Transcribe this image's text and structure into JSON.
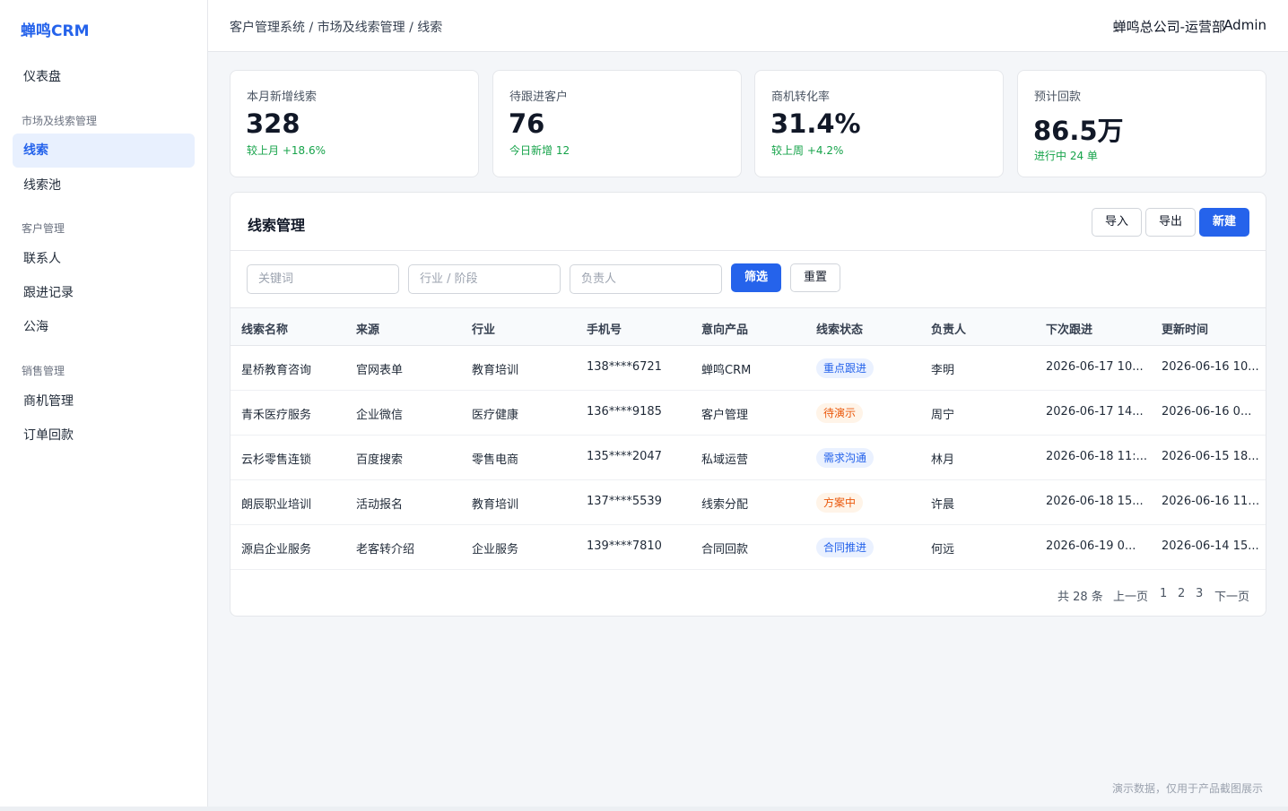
{
  "sidebar": {
    "brand": "蝉鸣CRM",
    "dashboard": "仪表盘",
    "group_market": "市场及线索管理",
    "leads": "线索",
    "lead_pool": "线索池",
    "group_customer": "客户管理",
    "contacts": "联系人",
    "followups": "跟进记录",
    "public_sea": "公海",
    "group_sales": "销售管理",
    "opportunities": "商机管理",
    "orders": "订单回款"
  },
  "header": {
    "breadcrumb": "客户管理系统 / 市场及线索管理 / 线索",
    "org": "蝉鸣总公司-运营部",
    "user": "Admin"
  },
  "stats": [
    {
      "label": "本月新增线索",
      "value": "328",
      "sub": "较上月 +18.6%"
    },
    {
      "label": "待跟进客户",
      "value": "76",
      "sub": "今日新增 12"
    },
    {
      "label": "商机转化率",
      "value": "31.4%",
      "sub": "较上周 +4.2%"
    },
    {
      "label": "预计回款",
      "value": "86.5万",
      "sub": "进行中 24 单"
    }
  ],
  "panel": {
    "title": "线索管理",
    "import_label": "导入",
    "export_label": "导出",
    "new_label": "新建"
  },
  "filters": {
    "keyword_placeholder": "关键词",
    "industry_placeholder": "行业 / 阶段",
    "owner_placeholder": "负责人",
    "filter_label": "筛选",
    "reset_label": "重置"
  },
  "table": {
    "headers": [
      "线索名称",
      "来源",
      "行业",
      "手机号",
      "意向产品",
      "线索状态",
      "负责人",
      "下次跟进",
      "更新时间"
    ],
    "rows": [
      {
        "name": "星桥教育咨询",
        "source": "官网表单",
        "industry": "教育培训",
        "phone": "138****6721",
        "product": "蝉鸣CRM",
        "status": "重点跟进",
        "owner": "李明",
        "next": "2026-06-17 10...",
        "updated": "2026-06-16 10..."
      },
      {
        "name": "青禾医疗服务",
        "source": "企业微信",
        "industry": "医疗健康",
        "phone": "136****9185",
        "product": "客户管理",
        "status": "待演示",
        "owner": "周宁",
        "next": "2026-06-17 14...",
        "updated": "2026-06-16 0..."
      },
      {
        "name": "云杉零售连锁",
        "source": "百度搜索",
        "industry": "零售电商",
        "phone": "135****2047",
        "product": "私域运营",
        "status": "需求沟通",
        "owner": "林月",
        "next": "2026-06-18 11:...",
        "updated": "2026-06-15 18..."
      },
      {
        "name": "朗辰职业培训",
        "source": "活动报名",
        "industry": "教育培训",
        "phone": "137****5539",
        "product": "线索分配",
        "status": "方案中",
        "owner": "许晨",
        "next": "2026-06-18 15...",
        "updated": "2026-06-16 11:..."
      },
      {
        "name": "源启企业服务",
        "source": "老客转介绍",
        "industry": "企业服务",
        "phone": "139****7810",
        "product": "合同回款",
        "status": "合同推进",
        "owner": "何远",
        "next": "2026-06-19 0...",
        "updated": "2026-06-14 15..."
      }
    ]
  },
  "pagination": {
    "total": "共 28 条",
    "prev": "上一页",
    "page1": "1",
    "page2": "2",
    "page3": "3",
    "next": "下一页"
  },
  "footer": {
    "note": "演示数据，仅用于产品截图展示"
  },
  "colors": {
    "accent": "#2563eb",
    "positive": "#16a34a",
    "tag_blue": "#2563eb",
    "tag_orange": "#ea580c"
  }
}
